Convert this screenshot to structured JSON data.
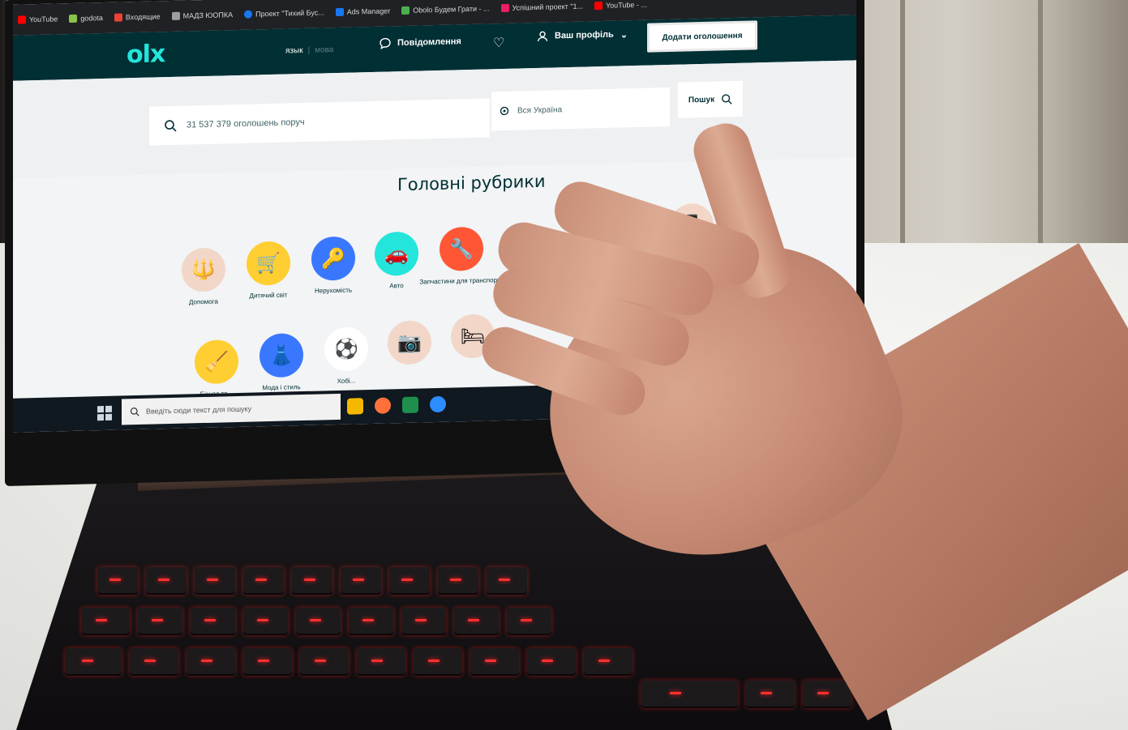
{
  "browser": {
    "bookmarks": [
      {
        "label": "YouTube",
        "icon": "youtube-icon",
        "color": "#ff0000"
      },
      {
        "label": "godota",
        "icon": "bookmark-icon",
        "color": "#8bc34a"
      },
      {
        "label": "Входящие",
        "icon": "gmail-icon",
        "color": "#ea4335"
      },
      {
        "label": "МАДЗ ЮОПКА",
        "icon": "bookmark-icon",
        "color": "#9e9e9e"
      },
      {
        "label": "Проект \"Тихий Бус...",
        "icon": "facebook-icon",
        "color": "#1877f2"
      },
      {
        "label": "Ads Manager",
        "icon": "ads-icon",
        "color": "#1877f2"
      },
      {
        "label": "Obolo Будем Грати - ...",
        "icon": "bookmark-icon",
        "color": "#4caf50"
      },
      {
        "label": "Успішний проект \"1...",
        "icon": "bookmark-icon",
        "color": "#e91e63"
      },
      {
        "label": "YouTube - ...",
        "icon": "youtube-icon",
        "color": "#ff0000"
      }
    ]
  },
  "header": {
    "logo": "olx",
    "lang_active": "язык",
    "lang_other": "мова",
    "messages": "Повідомлення",
    "profile": "Ваш профіль",
    "add_button": "Додати оголошення",
    "colors": {
      "bg": "#002f34",
      "logo": "#23e5db"
    }
  },
  "search": {
    "placeholder": "31 537 379 оголошень поруч",
    "location": "Вся Україна",
    "button": "Пошук"
  },
  "categories": {
    "title": "Головні рубрики",
    "row1": [
      {
        "label": "Допомога",
        "icon": "ukraine-emblem-icon",
        "color": "#f2d7c9"
      },
      {
        "label": "Дитячий світ",
        "icon": "stroller-icon",
        "color": "#ffce32"
      },
      {
        "label": "Нерухомість",
        "icon": "key-icon",
        "color": "#3a77ff"
      },
      {
        "label": "Авто",
        "icon": "car-icon",
        "color": "#23e5db"
      },
      {
        "label": "Запчастини для транспорту",
        "icon": "wrench-icon",
        "color": "#ff5636"
      },
      {
        "label": "",
        "icon": "briefcase-icon",
        "color": "#f2d7c9"
      },
      {
        "label": "",
        "icon": "phone-icon",
        "color": "#f2d7c9"
      }
    ],
    "row2": [
      {
        "label": "Бізнес та...",
        "icon": "shovel-icon",
        "color": "#ffce32"
      },
      {
        "label": "Мода і стиль",
        "icon": "dress-icon",
        "color": "#3a77ff"
      },
      {
        "label": "Хобі...",
        "icon": "ball-icon",
        "color": "#ffffff"
      },
      {
        "label": "",
        "icon": "camera-icon",
        "color": "#f2d7c9"
      },
      {
        "label": "",
        "icon": "bed-icon",
        "color": "#f2d7c9"
      }
    ]
  },
  "taskbar": {
    "search_placeholder": "Введіть сюди текст для пошуку"
  }
}
